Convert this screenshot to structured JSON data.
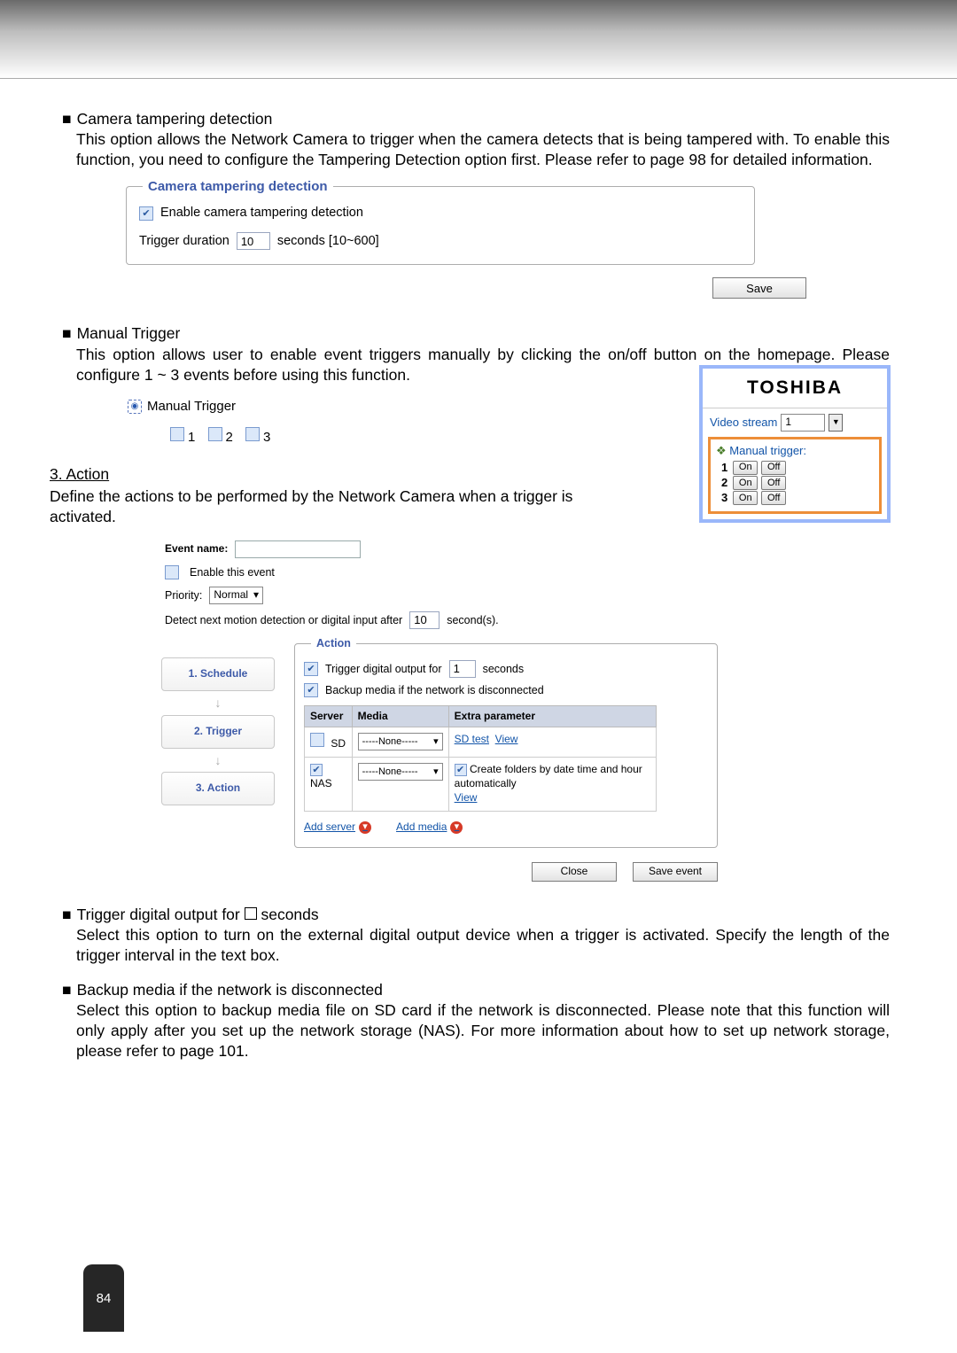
{
  "sec_a": {
    "title": "Camera tampering detection",
    "body": "This option allows the Network Camera to trigger when the camera detects that is being tampered with. To enable this function, you need to configure the Tampering Detection option first. Please refer to page 98 for detailed information."
  },
  "det_panel": {
    "head": "Camera tampering detection",
    "enable": "Enable camera tampering detection",
    "td_label": "Trigger duration",
    "td_value": "10",
    "td_suffix": "seconds [10~600]",
    "save": "Save"
  },
  "sec_b": {
    "title": "Manual Trigger",
    "body": "This option allows user to enable event triggers manually by clicking the on/off button on the homepage. Please configure 1 ~ 3 events before using this function."
  },
  "mt": {
    "label": "Manual Trigger",
    "n1": "1",
    "n2": "2",
    "n3": "3"
  },
  "toshiba": {
    "brand": "TOSHIBA",
    "vs_label": "Video stream",
    "vs_value": "1",
    "mt_label": "Manual trigger:",
    "rows": [
      {
        "n": "1",
        "on": "On",
        "off": "Off"
      },
      {
        "n": "2",
        "on": "On",
        "off": "Off"
      },
      {
        "n": "3",
        "on": "On",
        "off": "Off"
      }
    ]
  },
  "sec3": {
    "h": "3. Action",
    "desc": "Define the actions to be performed by the Network Camera when a trigger is activated."
  },
  "ev": {
    "name_l": "Event name:",
    "enable": "Enable this event",
    "priority_l": "Priority:",
    "priority_v": "Normal",
    "detect_l1": "Detect next motion detection or digital input after",
    "detect_v": "10",
    "detect_l2": "second(s).",
    "action_head": "Action",
    "steps": {
      "s1": "1.  Schedule",
      "s2": "2.  Trigger",
      "s3": "3.  Action"
    },
    "tdo": "Trigger digital output for",
    "tdo_v": "1",
    "tdo_suf": "seconds",
    "backup": "Backup media if the network is disconnected",
    "tbl": {
      "h1": "Server",
      "h2": "Media",
      "h3": "Extra parameter",
      "sd": "SD",
      "none": "-----None-----",
      "sdtest": "SD test",
      "view": "View",
      "nas": "NAS",
      "create": "Create folders by date time and hour automatically"
    },
    "add_s": "Add server",
    "add_m": "Add media",
    "close": "Close",
    "save": "Save event"
  },
  "sec_c": {
    "title_a": "Trigger digital output for ",
    "title_b": " seconds",
    "body": "Select this option to turn on the external digital output device when a trigger is activated. Specify the length of the trigger interval in the text box."
  },
  "sec_d": {
    "title": "Backup media if the network is disconnected",
    "body": "Select this option to backup media file on SD card if the network is disconnected. Please note that this function will only apply after you set up the network storage (NAS). For more information about how to set up network storage, please refer to page 101."
  },
  "page_no": "84"
}
